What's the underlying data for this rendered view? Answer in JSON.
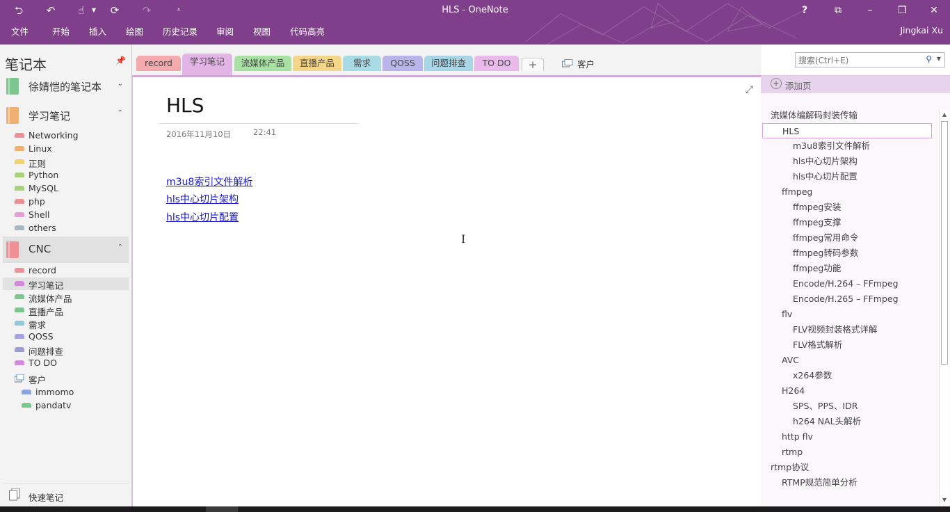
{
  "window": {
    "title": "HLS - OneNote",
    "user": "Jingkai Xu",
    "help_label": "?"
  },
  "menu": [
    "文件",
    "开始",
    "插入",
    "绘图",
    "历史记录",
    "审阅",
    "视图",
    "代码高亮"
  ],
  "notebooks_pane": {
    "title": "笔记本",
    "notebooks": [
      {
        "name": "徐婧恺的笔记本",
        "color": "#7cc78f",
        "expanded": false
      },
      {
        "name": "学习笔记",
        "color": "#f0b073",
        "expanded": true
      },
      {
        "name": "CNC",
        "color": "#ef8f96",
        "expanded": true
      }
    ],
    "study_sections": [
      {
        "label": "Networking",
        "color": "#ef8f96"
      },
      {
        "label": "Linux",
        "color": "#f0b073"
      },
      {
        "label": "正则",
        "color": "#f2d36b"
      },
      {
        "label": "Python",
        "color": "#a9d179"
      },
      {
        "label": "MySQL",
        "color": "#a9d179"
      },
      {
        "label": "php",
        "color": "#ef8f96"
      },
      {
        "label": "Shell",
        "color": "#e79bd8"
      },
      {
        "label": "others",
        "color": "#a8b6c2"
      }
    ],
    "cnc_sections": [
      {
        "label": "record",
        "color": "#ef8f96"
      },
      {
        "label": "学习笔记",
        "color": "#d38ad8"
      },
      {
        "label": "流媒体产品",
        "color": "#7cc78f"
      },
      {
        "label": "直播产品",
        "color": "#7cc78f"
      },
      {
        "label": "需求",
        "color": "#8ec9dc"
      },
      {
        "label": "QOSS",
        "color": "#a9a2e0"
      },
      {
        "label": "问题排查",
        "color": "#9e9cd8"
      },
      {
        "label": "TO DO",
        "color": "#d38ad8"
      }
    ],
    "group": {
      "label": "客户",
      "sections": [
        {
          "label": "immomo",
          "color": "#8aa4e0"
        },
        {
          "label": "pandatv",
          "color": "#7cc78f"
        }
      ]
    },
    "quick_notes": "快速笔记"
  },
  "section_tabs": [
    {
      "label": "record",
      "color": "#f4a9ad"
    },
    {
      "label": "学习笔记",
      "color": "#e3b5e6",
      "active": true
    },
    {
      "label": "流媒体产品",
      "color": "#a9e0a3"
    },
    {
      "label": "直播产品",
      "color": "#f4d68a"
    },
    {
      "label": "需求",
      "color": "#a9dbe6"
    },
    {
      "label": "QOSS",
      "color": "#b9b5ea"
    },
    {
      "label": "问题排查",
      "color": "#a9d6e6"
    },
    {
      "label": "TO DO",
      "color": "#e8b9ea"
    }
  ],
  "tab_add_label": "+",
  "group_tab_label": "客户",
  "search": {
    "placeholder": "搜索(Ctrl+E)"
  },
  "page": {
    "title": "HLS",
    "date": "2016年11月10日",
    "time": "22:41",
    "links": [
      "m3u8索引文件解析",
      "hls中心切片架构",
      "hls中心切片配置"
    ]
  },
  "page_list": {
    "add_page": "添加页",
    "items": [
      {
        "label": "流媒体编解码封装传输",
        "level": 0
      },
      {
        "label": "HLS",
        "level": 1,
        "selected": true
      },
      {
        "label": "m3u8索引文件解析",
        "level": 2
      },
      {
        "label": "hls中心切片架构",
        "level": 2
      },
      {
        "label": "hls中心切片配置",
        "level": 2
      },
      {
        "label": "ffmpeg",
        "level": 1
      },
      {
        "label": "ffmpeg安装",
        "level": 2
      },
      {
        "label": "ffmpeg支撑",
        "level": 2
      },
      {
        "label": "ffmpeg常用命令",
        "level": 2
      },
      {
        "label": "ffmpeg转码参数",
        "level": 2
      },
      {
        "label": "ffmpeg功能",
        "level": 2
      },
      {
        "label": "Encode/H.264 – FFmpeg",
        "level": 2
      },
      {
        "label": "Encode/H.265 – FFmpeg",
        "level": 2
      },
      {
        "label": "flv",
        "level": 1
      },
      {
        "label": "FLV视频封装格式详解",
        "level": 2
      },
      {
        "label": "FLV格式解析",
        "level": 2
      },
      {
        "label": "AVC",
        "level": 1
      },
      {
        "label": "x264参数",
        "level": 2
      },
      {
        "label": "H264",
        "level": 1
      },
      {
        "label": "SPS、PPS、IDR",
        "level": 2
      },
      {
        "label": "h264 NAL头解析",
        "level": 2
      },
      {
        "label": "http flv",
        "level": 1
      },
      {
        "label": "rtmp",
        "level": 1
      },
      {
        "label": "rtmp协议",
        "level": 0
      },
      {
        "label": "RTMP规范简单分析",
        "level": 1
      }
    ]
  }
}
